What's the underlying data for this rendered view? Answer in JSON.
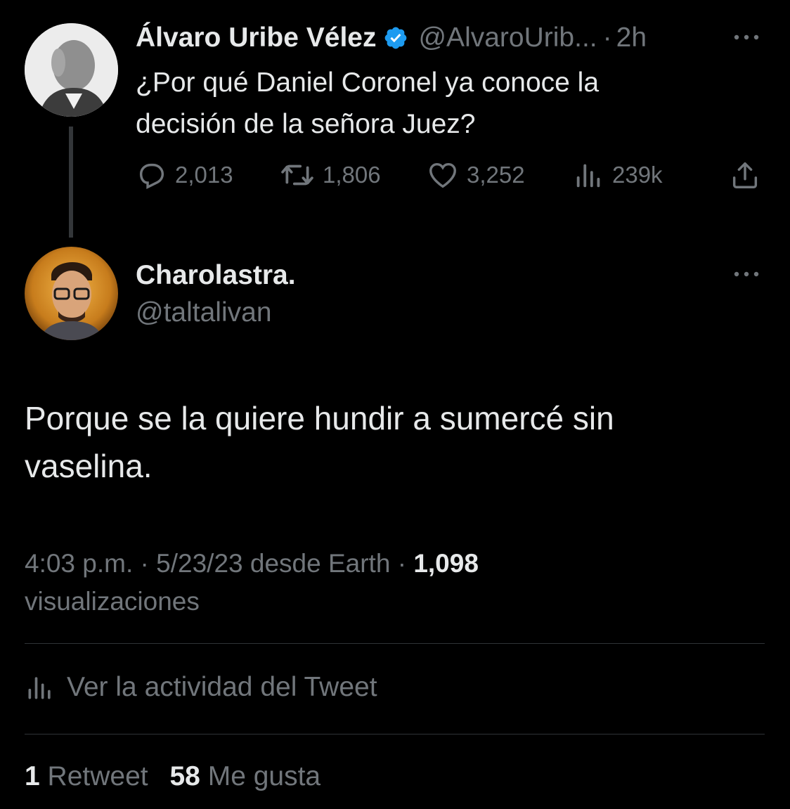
{
  "parent_tweet": {
    "author_name": "Álvaro Uribe Vélez",
    "handle": "@AlvaroUrib...",
    "separator": "·",
    "time_ago": "2h",
    "text_line1": "¿Por qué Daniel Coronel ya conoce la",
    "text_line2": "decisión de la señora Juez?",
    "replies": "2,013",
    "retweets": "1,806",
    "likes": "3,252",
    "views": "239k"
  },
  "reply_tweet": {
    "author_name": "Charolastra.",
    "handle": "@taltalivan",
    "text_line1": "Porque se la quiere hundir a sumercé sin",
    "text_line2": "vaselina.",
    "meta_time": "4:03 p.m.",
    "meta_sep1": "·",
    "meta_date_source": "5/23/23 desde Earth",
    "meta_sep2": "·",
    "views_count": "1,098",
    "views_label": "visualizaciones",
    "activity_label": "Ver la actividad del Tweet",
    "retweet_count": "1",
    "retweet_label": "Retweet",
    "like_count": "58",
    "like_label": "Me gusta"
  },
  "icons": {
    "verified": "verified-badge-icon",
    "more": "more-icon",
    "reply": "reply-icon",
    "retweet": "retweet-icon",
    "like": "like-icon",
    "views": "views-icon",
    "share": "share-icon",
    "activity": "activity-icon"
  },
  "colors": {
    "background": "#000000",
    "text": "#e7e9ea",
    "muted": "#71767b",
    "verified": "#1d9bf0",
    "divider": "#2f3336"
  }
}
